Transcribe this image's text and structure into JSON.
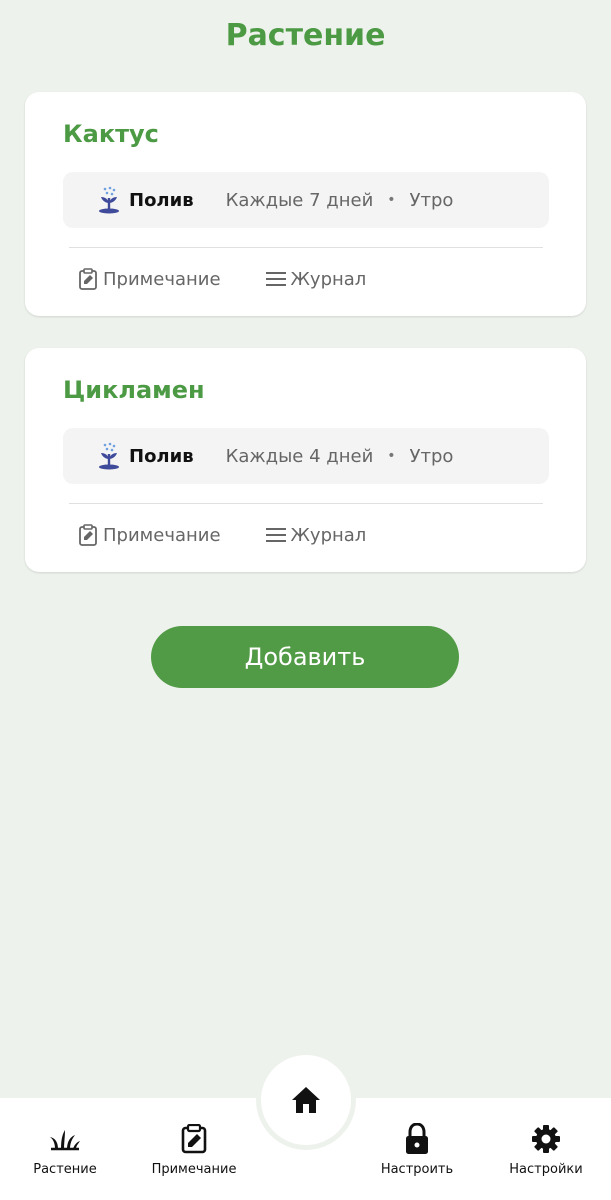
{
  "header": {
    "title": "Растение"
  },
  "plants": [
    {
      "name": "Кактус",
      "schedule": {
        "kind": "Полив",
        "frequency": "Каждые 7 дней",
        "separator": "•",
        "time": "Утро"
      },
      "actions": {
        "note": "Примечание",
        "journal": "Журнал"
      }
    },
    {
      "name": "Цикламен",
      "schedule": {
        "kind": "Полив",
        "frequency": "Каждые 4 дней",
        "separator": "•",
        "time": "Утро"
      },
      "actions": {
        "note": "Примечание",
        "journal": "Журнал"
      }
    }
  ],
  "add_button": {
    "label": "Добавить"
  },
  "bottom_nav": {
    "items": [
      {
        "label": "Растение",
        "icon": "grass-icon"
      },
      {
        "label": "Примечание",
        "icon": "note-icon"
      },
      {
        "label": "",
        "icon": "home-icon"
      },
      {
        "label": "Настроить",
        "icon": "lock-icon"
      },
      {
        "label": "Настройки",
        "icon": "gear-icon"
      }
    ]
  },
  "colors": {
    "accent": "#4C9A44",
    "button": "#529B46",
    "background": "#EEF2EC",
    "water_icon": "#3F4A9A"
  }
}
